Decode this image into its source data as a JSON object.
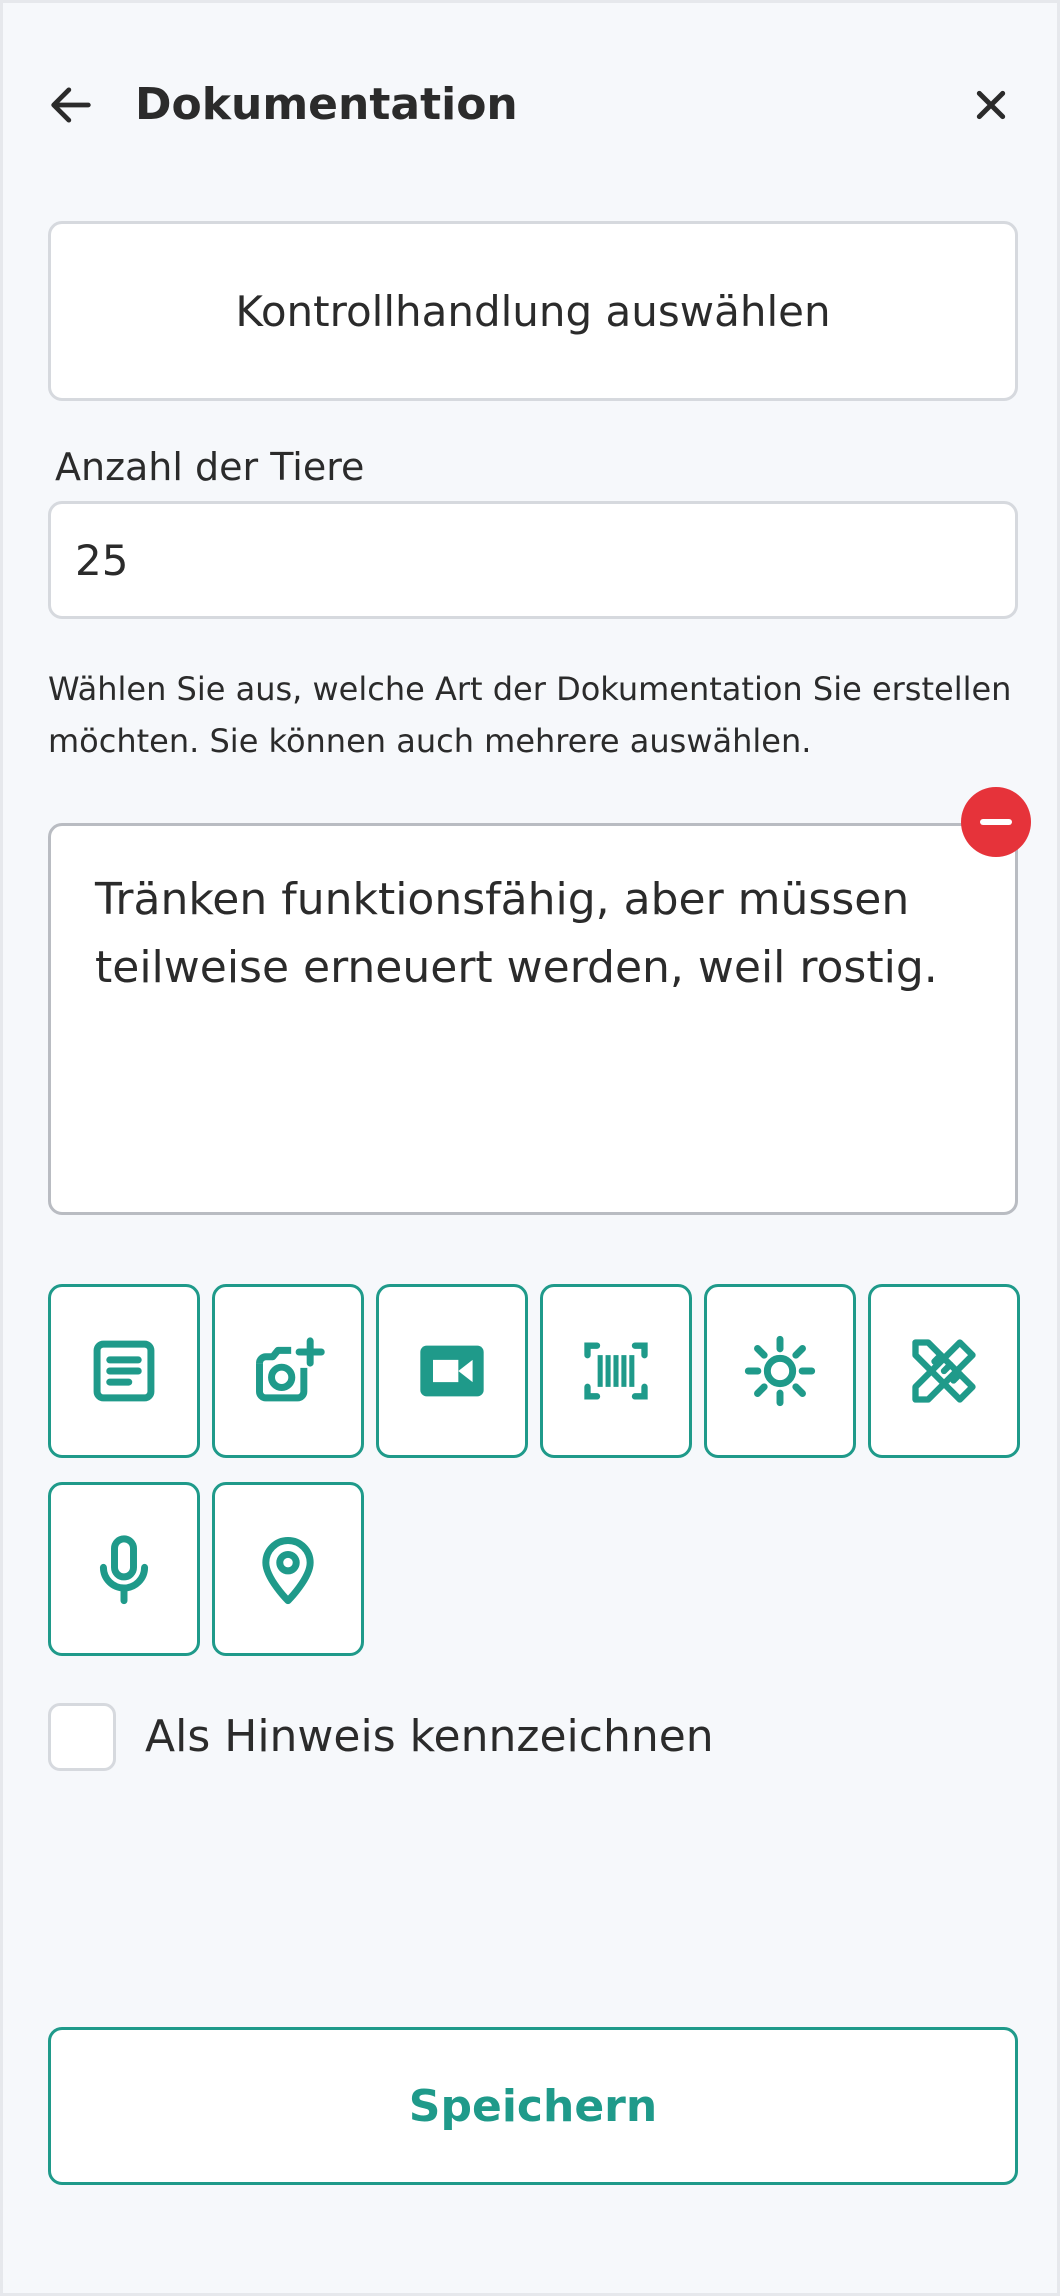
{
  "header": {
    "title": "Dokumentation",
    "back_icon": "arrow-left-icon",
    "close_icon": "close-icon"
  },
  "control_action": {
    "label": "Kontrollhandlung auswählen"
  },
  "animal_count": {
    "label": "Anzahl der Tiere",
    "value": "25"
  },
  "helper_text": "Wählen Sie aus, welche Art der Dokumentation Sie erstellen möchten. Sie können auch mehrere auswählen.",
  "note": {
    "text": "Tränken funktionsfähig, aber müssen teilweise erneuert werden, weil rostig."
  },
  "tools": [
    {
      "icon": "text-document-icon"
    },
    {
      "icon": "add-photo-icon"
    },
    {
      "icon": "video-camera-icon"
    },
    {
      "icon": "barcode-scan-icon"
    },
    {
      "icon": "brightness-icon"
    },
    {
      "icon": "measure-pencil-icon"
    },
    {
      "icon": "microphone-icon"
    },
    {
      "icon": "location-pin-icon"
    }
  ],
  "hint_checkbox": {
    "label": "Als Hinweis kennzeichnen",
    "checked": false
  },
  "save_button": {
    "label": "Speichern"
  },
  "colors": {
    "accent": "#1f9a8a",
    "danger": "#e6333a",
    "background": "#f6f8fb",
    "text": "#2b2b2b"
  }
}
